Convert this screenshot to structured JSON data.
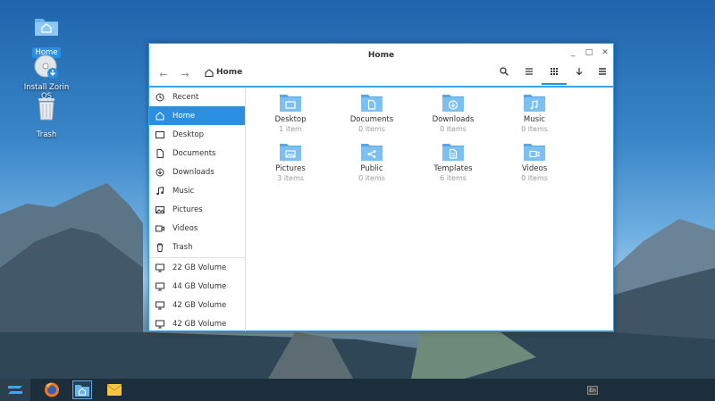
{
  "desktop": {
    "icons": [
      {
        "label": "Home",
        "icon": "home-folder-icon"
      },
      {
        "label": "Install Zorin OS",
        "icon": "install-disc-icon"
      },
      {
        "label": "Trash",
        "icon": "trash-icon"
      }
    ]
  },
  "window": {
    "title": "Home",
    "controls": {
      "minimize": "_",
      "maximize": "□",
      "close": "✕"
    },
    "toolbar": {
      "back": "←",
      "forward": "→",
      "breadcrumb": "Home",
      "search": "search-icon",
      "list_view": "list-view-icon",
      "grid_view": "grid-view-icon",
      "sort": "sort-down-icon",
      "menu": "hamburger-menu-icon"
    },
    "sidebar": {
      "places": [
        {
          "label": "Recent",
          "icon": "clock-icon"
        },
        {
          "label": "Home",
          "icon": "home-icon",
          "active": true
        },
        {
          "label": "Desktop",
          "icon": "desktop-icon"
        },
        {
          "label": "Documents",
          "icon": "document-icon"
        },
        {
          "label": "Downloads",
          "icon": "download-icon"
        },
        {
          "label": "Music",
          "icon": "music-icon"
        },
        {
          "label": "Pictures",
          "icon": "picture-icon"
        },
        {
          "label": "Videos",
          "icon": "video-icon"
        },
        {
          "label": "Trash",
          "icon": "trash-icon"
        }
      ],
      "volumes": [
        {
          "label": "22 GB Volume",
          "icon": "drive-icon"
        },
        {
          "label": "44 GB Volume",
          "icon": "drive-icon"
        },
        {
          "label": "42 GB Volume",
          "icon": "drive-icon"
        },
        {
          "label": "42 GB Volume",
          "icon": "drive-icon"
        }
      ]
    },
    "folders": [
      {
        "name": "Desktop",
        "count": "1 item",
        "glyph": "desktop"
      },
      {
        "name": "Documents",
        "count": "0 items",
        "glyph": "document"
      },
      {
        "name": "Downloads",
        "count": "0 items",
        "glyph": "download"
      },
      {
        "name": "Music",
        "count": "0 items",
        "glyph": "music"
      },
      {
        "name": "Pictures",
        "count": "3 items",
        "glyph": "picture"
      },
      {
        "name": "Public",
        "count": "0 items",
        "glyph": "share"
      },
      {
        "name": "Templates",
        "count": "6 items",
        "glyph": "template"
      },
      {
        "name": "Videos",
        "count": "0 items",
        "glyph": "video"
      }
    ]
  },
  "taskbar": {
    "items": [
      "zorin-menu-icon",
      "firefox-icon",
      "files-icon",
      "mail-icon"
    ],
    "tray": {
      "keyboard": "En"
    }
  },
  "colors": {
    "accent": "#2b8fe0",
    "folder": "#6ab4ec",
    "taskbar": "#1c2d3b"
  }
}
